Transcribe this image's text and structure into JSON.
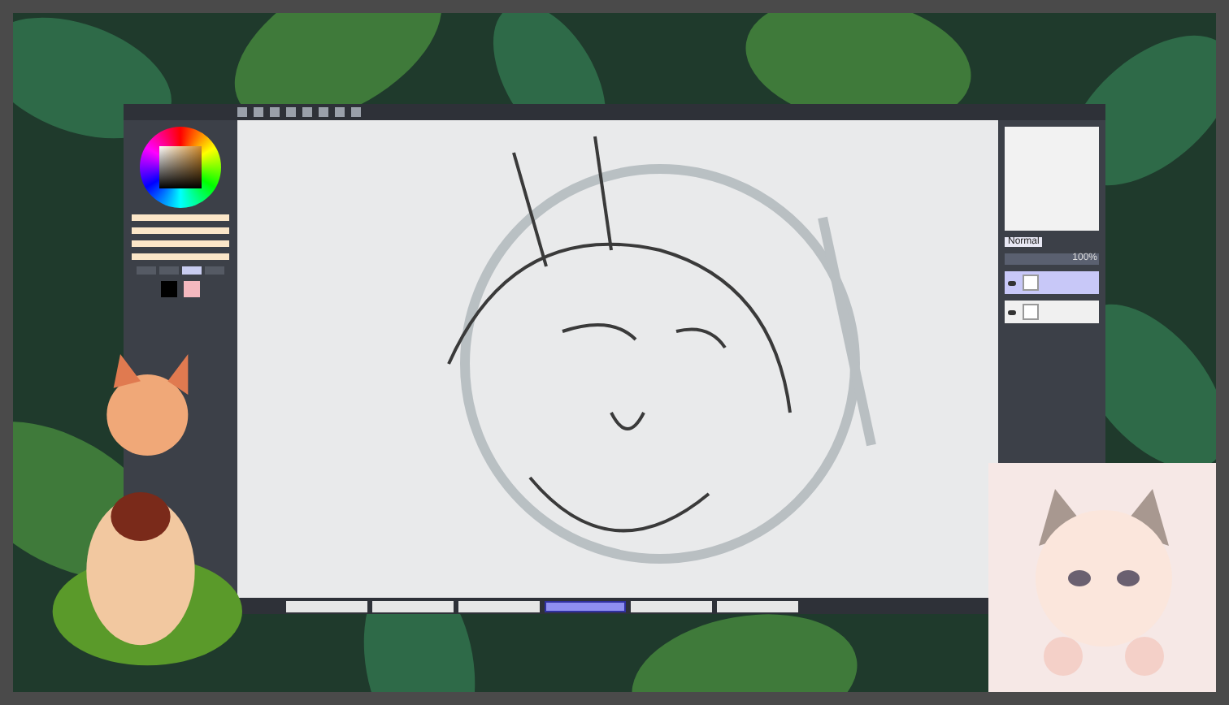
{
  "app": {
    "tool_tabs": [
      {
        "selected": false
      },
      {
        "selected": false
      },
      {
        "selected": true
      },
      {
        "selected": false
      }
    ],
    "sliders": [
      {
        "level": 1.0
      },
      {
        "level": 1.0
      },
      {
        "level": 1.0
      },
      {
        "level": 1.0
      }
    ],
    "layer_settings": {
      "mode": "Normal",
      "opacity": "100%",
      "level": 1.0
    },
    "layers": [
      {
        "selected": true,
        "visible": true
      },
      {
        "selected": false,
        "visible": true
      }
    ],
    "document_tabs": [
      {
        "selected": false
      },
      {
        "selected": false
      },
      {
        "selected": false
      },
      {
        "selected": true
      },
      {
        "selected": false
      },
      {
        "selected": false
      }
    ]
  }
}
